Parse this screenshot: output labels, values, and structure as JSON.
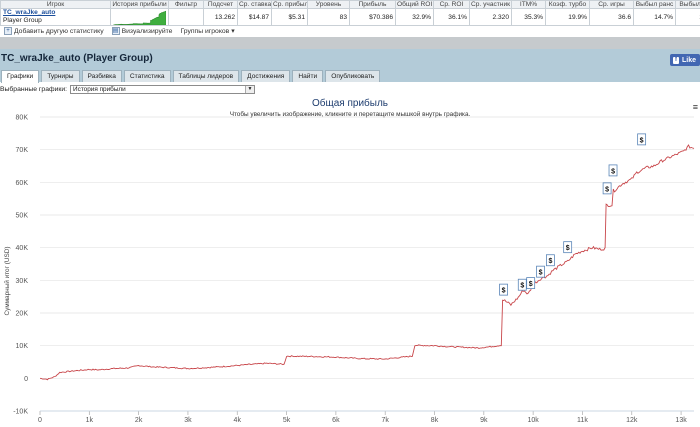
{
  "stats_table": {
    "headers": [
      "Игрок",
      "История прибыли",
      "Фильтр",
      "Подсчет",
      "Ср. ставка",
      "Ср. прибыль",
      "Уровень",
      "Прибыль",
      "Общий ROI",
      "Ср. ROI",
      "Ср. участник",
      "ITM%",
      "Коэф. турбо",
      "Ср. игры",
      "Выбыл ранс",
      "Выбыл позд"
    ],
    "player_name": "TC_wraJke_auto",
    "player_group": "Player Group",
    "cells": [
      "",
      "13.262",
      "$14.87",
      "$5.31",
      "83",
      "$70.386",
      "32.9%",
      "36.1%",
      "2.320",
      "35.3%",
      "19.9%",
      "36.6",
      "14.7%",
      "12.1%"
    ]
  },
  "actions": {
    "add_stats": "Добавить другую статистику",
    "visualize": "Визуализируйте",
    "player_groups": "Группы игроков"
  },
  "page_title": "TC_wraJke_auto (Player Group)",
  "like_label": "Like",
  "tabs": [
    "Графики",
    "Турниры",
    "Разбивка",
    "Статистика",
    "Таблицы лидеров",
    "Достижения",
    "Найти",
    "Опубликовать"
  ],
  "selector": {
    "label": "Выбранные графики:",
    "value": "История прибыли"
  },
  "chart_data": {
    "type": "line",
    "title": "Общая прибыль",
    "subtitle": "Чтобы увеличить изображение, кликните и перетащите мышкой внутрь графика.",
    "ylabel": "Суммарный итог (USD)",
    "xlim": [
      0,
      13262
    ],
    "ylim": [
      -10000,
      80000
    ],
    "x_ticks": [
      0,
      1000,
      2000,
      3000,
      4000,
      5000,
      6000,
      7000,
      8000,
      9000,
      10000,
      11000,
      12000,
      13000
    ],
    "x_tick_labels": [
      "0",
      "1k",
      "2k",
      "3k",
      "4k",
      "5k",
      "6k",
      "7k",
      "8k",
      "9k",
      "10k",
      "11k",
      "12k",
      "13k"
    ],
    "y_ticks": [
      -10000,
      0,
      10000,
      20000,
      30000,
      40000,
      50000,
      60000,
      70000,
      80000
    ],
    "y_tick_labels": [
      "-10K",
      "0",
      "10K",
      "20K",
      "30K",
      "40K",
      "50K",
      "60K",
      "70K",
      "80K"
    ],
    "series": [
      {
        "color": "#c8464a",
        "points": [
          [
            0,
            0
          ],
          [
            150,
            -300
          ],
          [
            300,
            500
          ],
          [
            400,
            1800
          ],
          [
            700,
            2300
          ],
          [
            1000,
            2700
          ],
          [
            1200,
            2600
          ],
          [
            1500,
            3000
          ],
          [
            1800,
            3200
          ],
          [
            2000,
            3900
          ],
          [
            2300,
            3500
          ],
          [
            2600,
            3300
          ],
          [
            3000,
            3000
          ],
          [
            3400,
            3300
          ],
          [
            3800,
            3700
          ],
          [
            4200,
            4200
          ],
          [
            4600,
            4600
          ],
          [
            4950,
            4300
          ],
          [
            5000,
            6800
          ],
          [
            5500,
            6700
          ],
          [
            6000,
            6500
          ],
          [
            6300,
            6200
          ],
          [
            6600,
            6000
          ],
          [
            7000,
            5900
          ],
          [
            7300,
            6400
          ],
          [
            7550,
            6800
          ],
          [
            7600,
            10100
          ],
          [
            8000,
            10000
          ],
          [
            8300,
            9700
          ],
          [
            8600,
            9500
          ],
          [
            8900,
            9300
          ],
          [
            9200,
            9800
          ],
          [
            9380,
            10200
          ],
          [
            9400,
            24000
          ],
          [
            9550,
            22500
          ],
          [
            9700,
            24800
          ],
          [
            9800,
            27000
          ],
          [
            9900,
            25800
          ],
          [
            10000,
            28700
          ],
          [
            10150,
            30500
          ],
          [
            10300,
            31500
          ],
          [
            10400,
            33000
          ],
          [
            10550,
            34500
          ],
          [
            10700,
            35800
          ],
          [
            10850,
            38000
          ],
          [
            11000,
            39000
          ],
          [
            11200,
            40000
          ],
          [
            11350,
            39500
          ],
          [
            11460,
            39800
          ],
          [
            11500,
            53000
          ],
          [
            11650,
            57500
          ],
          [
            11800,
            59500
          ],
          [
            12000,
            61000
          ],
          [
            12100,
            63000
          ],
          [
            12300,
            64500
          ],
          [
            12450,
            65000
          ],
          [
            12600,
            66500
          ],
          [
            12750,
            67500
          ],
          [
            12900,
            68500
          ],
          [
            13050,
            69500
          ],
          [
            13150,
            71000
          ],
          [
            13262,
            70400
          ]
        ]
      }
    ],
    "flags": [
      {
        "x": 9400,
        "y": 27000,
        "label": "$"
      },
      {
        "x": 9780,
        "y": 28500,
        "label": "$"
      },
      {
        "x": 9950,
        "y": 29000,
        "label": "$"
      },
      {
        "x": 10150,
        "y": 32500,
        "label": "$"
      },
      {
        "x": 10350,
        "y": 36000,
        "label": "$"
      },
      {
        "x": 10700,
        "y": 40000,
        "label": "$"
      },
      {
        "x": 11500,
        "y": 58000,
        "label": "$"
      },
      {
        "x": 11620,
        "y": 63500,
        "label": "$"
      },
      {
        "x": 12200,
        "y": 73000,
        "label": "$"
      }
    ]
  }
}
